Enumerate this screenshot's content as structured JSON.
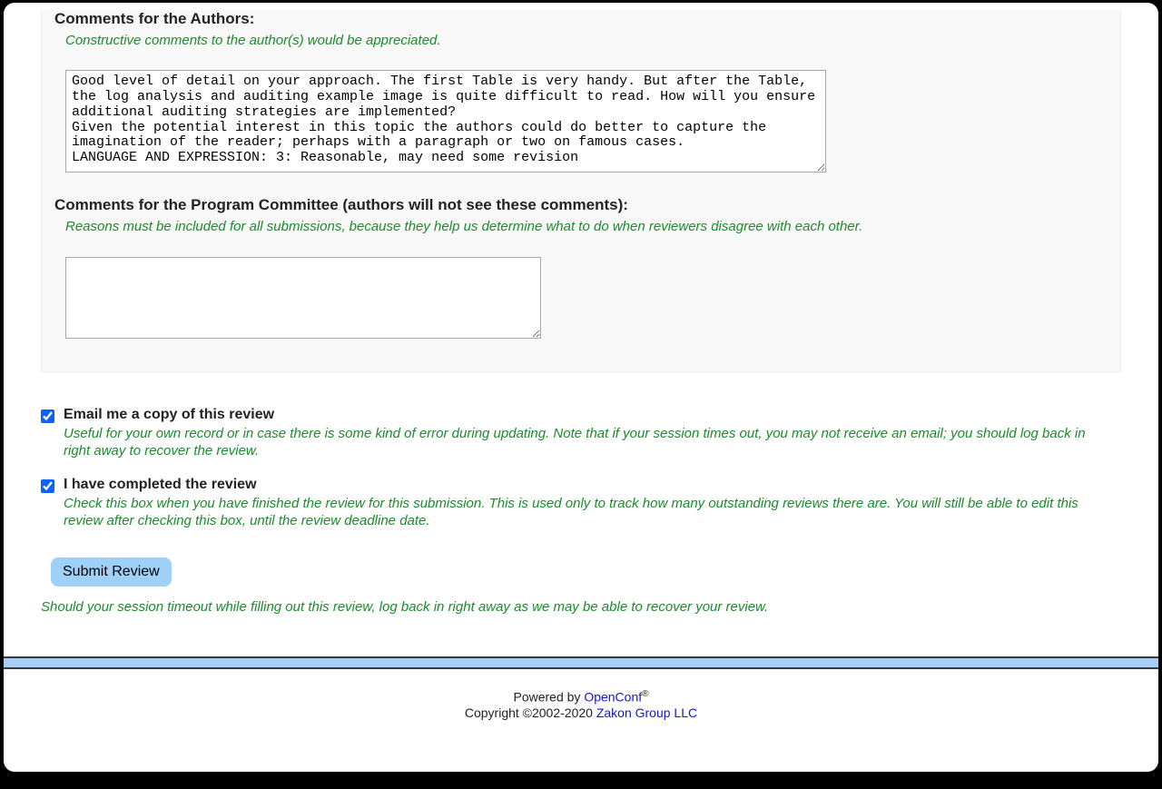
{
  "fields": {
    "authors": {
      "title": "Comments for the Authors:",
      "hint": "Constructive comments to the author(s) would be appreciated.",
      "value": "Good level of detail on your approach. The first Table is very handy. But after the Table, the log analysis and auditing example image is quite difficult to read. How will you ensure additional auditing strategies are implemented?\nGiven the potential interest in this topic the authors could do better to capture the imagination of the reader; perhaps with a paragraph or two on famous cases.\nLANGUAGE AND EXPRESSION: 3: Reasonable, may need some revision"
    },
    "pc": {
      "title": "Comments for the Program Committee (authors will not see these comments):",
      "hint": "Reasons must be included for all submissions, because they help us determine what to do when reviewers disagree with each other.",
      "value": ""
    }
  },
  "checks": {
    "email_copy": {
      "label": "Email me a copy of this review",
      "desc": "Useful for your own record or in case there is some kind of error during updating. Note that if your session times out, you may not receive an email; you should log back in right away to recover the review.",
      "checked": true
    },
    "completed": {
      "label": "I have completed the review",
      "desc": "Check this box when you have finished the review for this submission. This is used only to track how many outstanding reviews there are. You will still be able to edit this review after checking this box, until the review deadline date.",
      "checked": true
    }
  },
  "submit_label": "Submit Review",
  "timeout_note": "Should your session timeout while filling out this review, log back in right away as we may be able to recover your review.",
  "footer": {
    "powered_by_prefix": "Powered by ",
    "powered_by_link": "OpenConf",
    "powered_by_sup": "®",
    "copyright_prefix": "Copyright ©2002-2020 ",
    "copyright_link": "Zakon Group LLC"
  }
}
